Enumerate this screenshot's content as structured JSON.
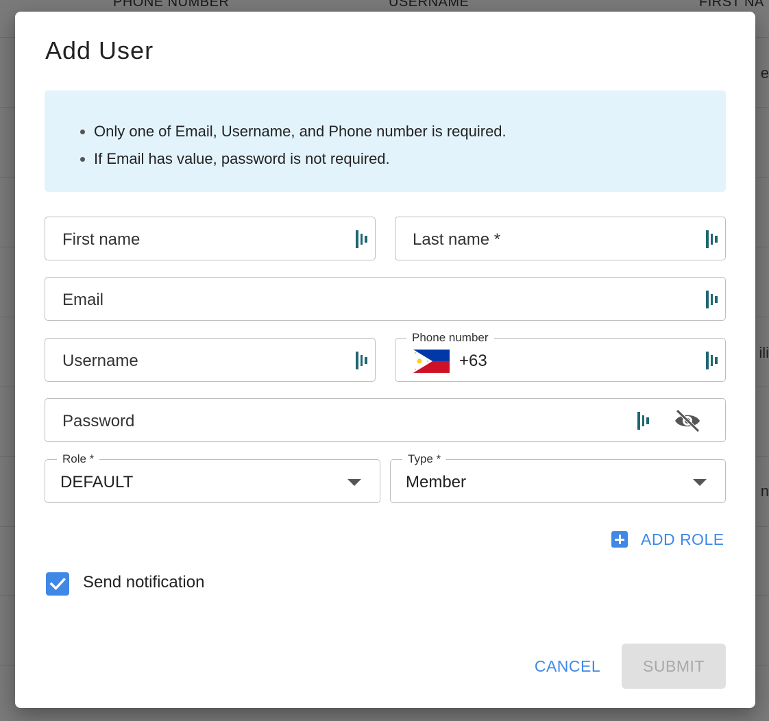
{
  "background_table": {
    "headers": [
      "PHONE NUMBER",
      "USERNAME",
      "FIRST NA"
    ],
    "right_fragments": [
      "e",
      "ili",
      "n"
    ]
  },
  "dialog": {
    "title": "Add User",
    "info_notes": [
      "Only one of Email, Username, and Phone number is required.",
      "If Email has value, password is not required."
    ],
    "fields": {
      "first_name": {
        "placeholder": "First name"
      },
      "last_name": {
        "placeholder": "Last name *"
      },
      "email": {
        "placeholder": "Email"
      },
      "username": {
        "placeholder": "Username"
      },
      "phone": {
        "label": "Phone number",
        "country_code": "+63",
        "flag_icon": "philippines-flag-icon"
      },
      "password": {
        "placeholder": "Password"
      },
      "role": {
        "label": "Role *",
        "value": "DEFAULT"
      },
      "type": {
        "label": "Type *",
        "value": "Member"
      }
    },
    "add_role_label": "ADD ROLE",
    "send_notification": {
      "label": "Send notification",
      "checked": true
    },
    "cancel_label": "CANCEL",
    "submit_label": "SUBMIT",
    "colors": {
      "accent": "#3f88e6",
      "info_bg": "#e3f3fc",
      "keypass_icon": "#1d6670"
    }
  }
}
